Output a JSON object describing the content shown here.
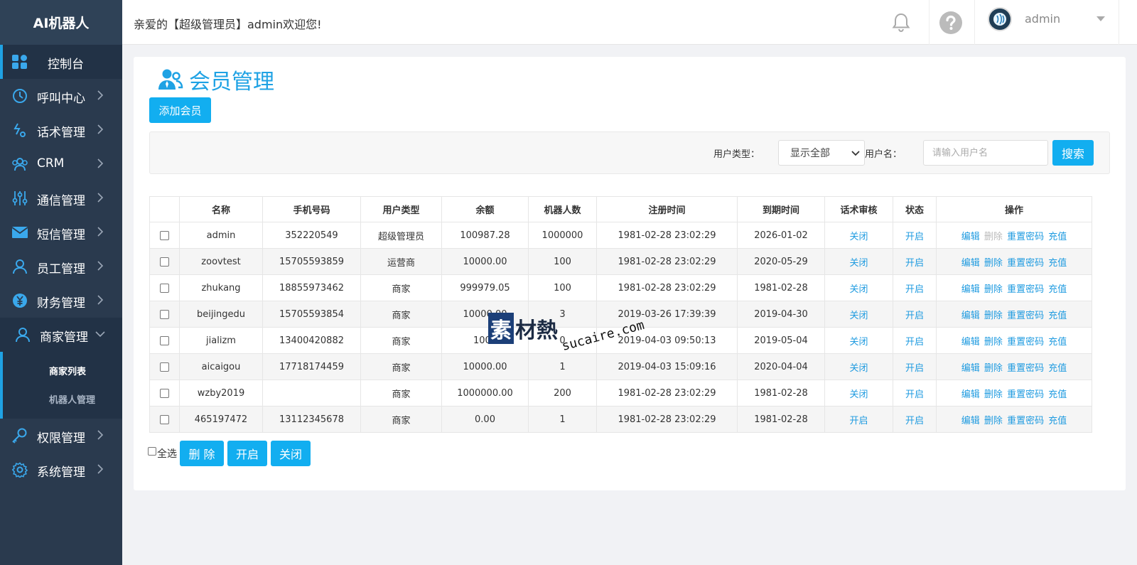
{
  "sidebar": {
    "brand": "AI机器人",
    "items": [
      {
        "label": "控制台"
      },
      {
        "label": "呼叫中心"
      },
      {
        "label": "话术管理"
      },
      {
        "label": "CRM"
      },
      {
        "label": "通信管理"
      },
      {
        "label": "短信管理"
      },
      {
        "label": "员工管理"
      },
      {
        "label": "财务管理"
      },
      {
        "label": "商家管理"
      },
      {
        "label": "权限管理"
      },
      {
        "label": "系统管理"
      }
    ],
    "submenu": [
      {
        "label": "商家列表"
      },
      {
        "label": "机器人管理"
      }
    ]
  },
  "topbar": {
    "welcome": "亲爱的【超级管理员】admin欢迎您!",
    "username": "admin"
  },
  "page": {
    "title": "会员管理",
    "add_button": "添加会员"
  },
  "filter": {
    "user_type_label": "用户类型：",
    "user_type_value": "显示全部",
    "username_label": "用户名：",
    "username_placeholder": "请输入用户名",
    "search_button": "搜索"
  },
  "table": {
    "headers": [
      "名称",
      "手机号码",
      "用户类型",
      "余额",
      "机器人数",
      "注册时间",
      "到期时间",
      "话术审核",
      "状态",
      "操作"
    ],
    "action_labels": {
      "edit": "编辑",
      "delete": "删除",
      "reset": "重置密码",
      "recharge": "充值"
    },
    "rows": [
      {
        "name": "admin",
        "phone": "352220549",
        "type": "超级管理员",
        "balance": "100987.28",
        "robots": "1000000",
        "reg": "1981-02-28 23:02:29",
        "exp": "2026-01-02",
        "review": "关闭",
        "status": "开启"
      },
      {
        "name": "zoovtest",
        "phone": "15705593859",
        "type": "运营商",
        "balance": "10000.00",
        "robots": "100",
        "reg": "1981-02-28 23:02:29",
        "exp": "2020-05-29",
        "review": "关闭",
        "status": "开启"
      },
      {
        "name": "zhukang",
        "phone": "18855973462",
        "type": "商家",
        "balance": "999979.05",
        "robots": "100",
        "reg": "1981-02-28 23:02:29",
        "exp": "1981-02-28",
        "review": "关闭",
        "status": "开启"
      },
      {
        "name": "beijingedu",
        "phone": "15705593854",
        "type": "商家",
        "balance": "10000.00",
        "robots": "3",
        "reg": "2019-03-26 17:39:39",
        "exp": "2019-04-30",
        "review": "关闭",
        "status": "开启"
      },
      {
        "name": "jializm",
        "phone": "13400420882",
        "type": "商家",
        "balance": "1000",
        "robots": "0",
        "reg": "2019-04-03 09:50:13",
        "exp": "2019-05-04",
        "review": "关闭",
        "status": "开启"
      },
      {
        "name": "aicaigou",
        "phone": "17718174459",
        "type": "商家",
        "balance": "10000.00",
        "robots": "1",
        "reg": "2019-04-03 15:09:16",
        "exp": "2020-04-04",
        "review": "关闭",
        "status": "开启"
      },
      {
        "name": "wzby2019",
        "phone": "",
        "type": "商家",
        "balance": "1000000.00",
        "robots": "200",
        "reg": "1981-02-28 23:02:29",
        "exp": "1981-02-28",
        "review": "关闭",
        "status": "开启"
      },
      {
        "name": "465197472",
        "phone": "13112345678",
        "type": "商家",
        "balance": "0.00",
        "robots": "1",
        "reg": "1981-02-28 23:02:29",
        "exp": "1981-02-28",
        "review": "开启",
        "status": "开启"
      }
    ]
  },
  "bottom": {
    "select_all": "全选",
    "delete_button": "删 除",
    "enable_button": "开启",
    "disable_button": "关闭"
  },
  "watermark": {
    "box_char": "素",
    "text": "材熱",
    "url": "sucaire.com"
  },
  "colors": {
    "sidebar_bg": "#2a3a4e",
    "accent": "#12aef0",
    "link": "#1f9be0"
  }
}
